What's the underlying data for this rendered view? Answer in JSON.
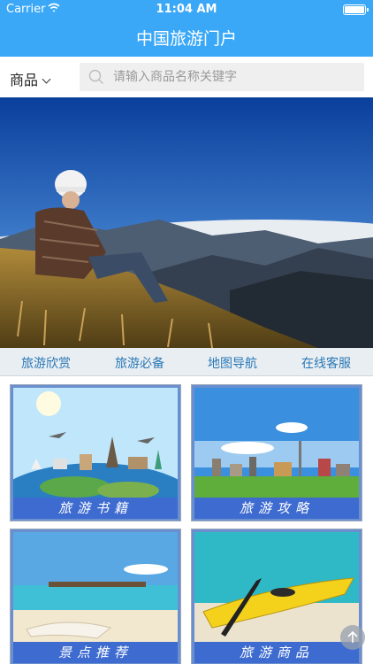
{
  "status_bar": {
    "carrier": "Carrier",
    "time": "11:04 AM"
  },
  "nav": {
    "title": "中国旅游门户"
  },
  "search": {
    "category": "商品",
    "placeholder": "请输入商品名称关键字"
  },
  "banner": {
    "slide_count": 4,
    "active_slide": 2
  },
  "tabs": [
    {
      "label": "旅游欣赏"
    },
    {
      "label": "旅游必备"
    },
    {
      "label": "地图导航"
    },
    {
      "label": "在线客服"
    }
  ],
  "cards": [
    {
      "caption": "旅游书籍"
    },
    {
      "caption": "旅游攻略"
    },
    {
      "caption": "景点推荐"
    },
    {
      "caption": "旅游商品"
    }
  ],
  "colors": {
    "nav_blue": "#3aa8f7",
    "tab_text": "#2a78b6",
    "caption_bg": "#3e6bd0"
  }
}
